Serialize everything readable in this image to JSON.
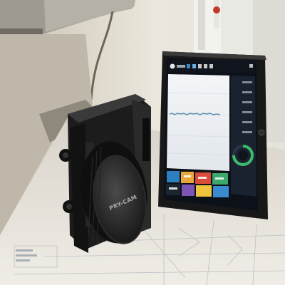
{
  "photo": {
    "camera_label": "PRY-CAM",
    "tablet_screen": {
      "bg": "#0c1018",
      "content_bg": "#e9edf0",
      "tile_colors": [
        "#2e7fbf",
        "#e9a63a",
        "#d94c3a",
        "#3aa86b",
        "#7c55b4",
        "#eec43c"
      ],
      "gauge_color": "#3cb96a"
    }
  }
}
